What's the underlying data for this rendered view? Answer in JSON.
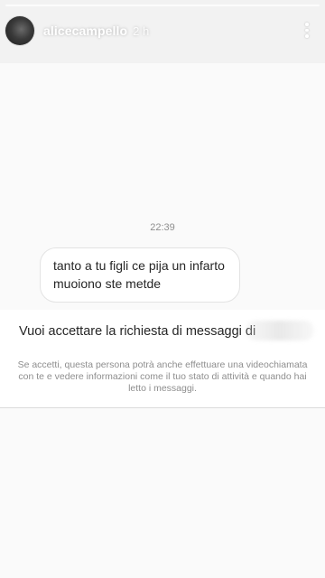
{
  "header": {
    "username": "alicecampello",
    "time_ago": "2 h"
  },
  "icons": {
    "avatar": "avatar-photo",
    "more": "more-vertical-icon"
  },
  "chat": {
    "timestamp": "22:39",
    "message": {
      "line1": "tanto a tu figli ce pija un infarto",
      "line2": "muoiono ste metde"
    }
  },
  "request": {
    "title": "Vuoi accettare la richiesta di messaggi di",
    "description": "Se accetti, questa persona potrà anche effettuare una videochiamata con te e vedere informazioni come il tuo stato di attività e quando hai letto i messaggi."
  },
  "colors": {
    "text_primary": "#262626",
    "text_secondary": "#8e8e8e",
    "divider": "#dbdbdb"
  }
}
